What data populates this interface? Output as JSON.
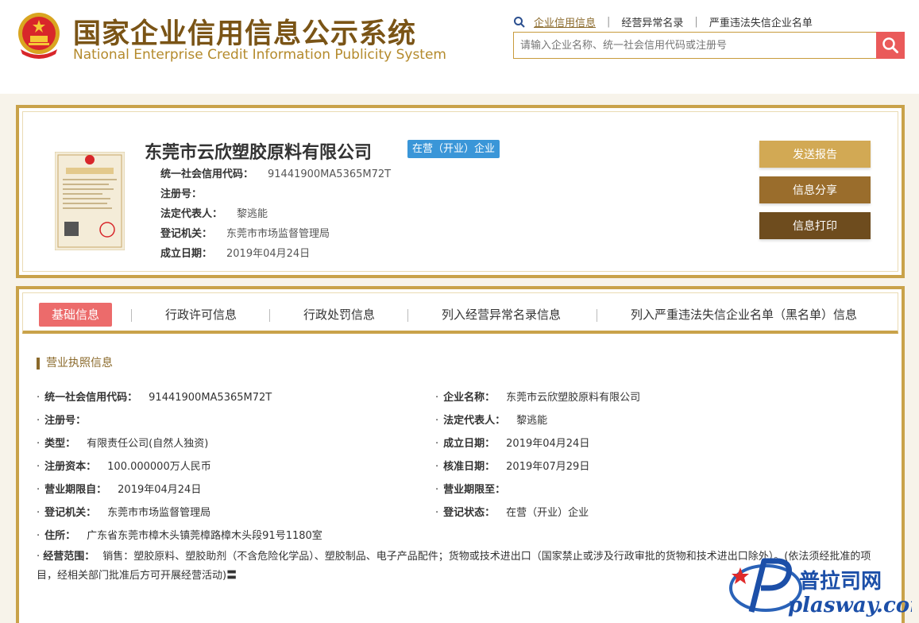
{
  "header": {
    "title_cn": "国家企业信用信息公示系统",
    "title_en": "National Enterprise Credit Information Publicity System",
    "nav": [
      "企业信用信息",
      "经营异常名录",
      "严重违法失信企业名单"
    ],
    "search_placeholder": "请输入企业名称、统一社会信用代码或注册号"
  },
  "company": {
    "name": "东莞市云欣塑胶原料有限公司",
    "status": "在营（开业）企业",
    "fields": [
      {
        "label": "统一社会信用代码：",
        "value": "91441900MA5365M72T"
      },
      {
        "label": "注册号：",
        "value": ""
      },
      {
        "label": "法定代表人：",
        "value": "黎逃能"
      },
      {
        "label": "登记机关：",
        "value": "东莞市市场监督管理局"
      },
      {
        "label": "成立日期：",
        "value": "2019年04月24日"
      }
    ],
    "buttons": {
      "send": "发送报告",
      "share": "信息分享",
      "print": "信息打印"
    }
  },
  "tabs": [
    "基础信息",
    "行政许可信息",
    "行政处罚信息",
    "列入经营异常名录信息",
    "列入严重违法失信企业名单（黑名单）信息"
  ],
  "license": {
    "section_title": "营业执照信息",
    "left": [
      {
        "label": "统一社会信用代码：",
        "value": "91441900MA5365M72T"
      },
      {
        "label": "注册号：",
        "value": ""
      },
      {
        "label": "类型：",
        "value": "有限责任公司(自然人独资)"
      },
      {
        "label": "注册资本：",
        "value": "100.000000万人民币"
      },
      {
        "label": "营业期限自：",
        "value": "2019年04月24日"
      },
      {
        "label": "登记机关：",
        "value": "东莞市市场监督管理局"
      },
      {
        "label": "住所：",
        "value": "广东省东莞市樟木头镇莞樟路樟木头段91号1180室"
      }
    ],
    "right": [
      {
        "label": "企业名称：",
        "value": "东莞市云欣塑胶原料有限公司"
      },
      {
        "label": "法定代表人：",
        "value": "黎逃能"
      },
      {
        "label": "成立日期：",
        "value": "2019年04月24日"
      },
      {
        "label": "核准日期：",
        "value": "2019年07月29日"
      },
      {
        "label": "营业期限至：",
        "value": ""
      },
      {
        "label": "登记状态：",
        "value": "在营（开业）企业"
      }
    ],
    "scope_label": "经营范围：",
    "scope_value": "销售：塑胶原料、塑胶助剂（不含危险化学品）、塑胶制品、电子产品配件；货物或技术进出口（国家禁止或涉及行政审批的货物和技术进出口除外）。(依法须经批准的项目，经相关部门批准后方可开展经营活动)〓"
  },
  "watermark": {
    "text": "普拉司网",
    "url": "plasway.com"
  }
}
